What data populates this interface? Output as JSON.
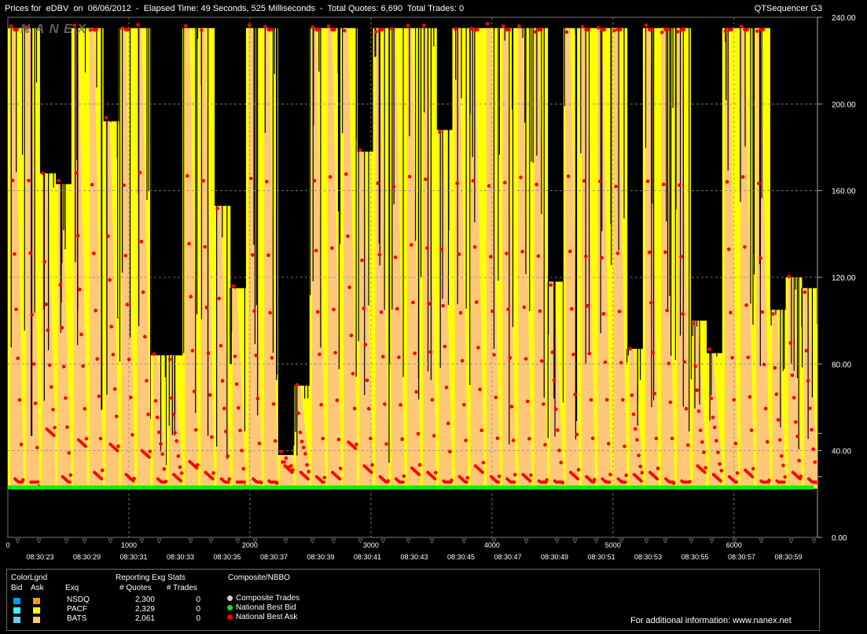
{
  "header": {
    "title": "Prices for  eDBV  on  06/06/2012  -  Elapsed Time: 49 Seconds, 525 Milliseconds  -  Total Quotes: 6,690  Total Trades: 0",
    "app_name": "QTSequencer G3",
    "watermark": "NANEX"
  },
  "colors": {
    "background": "#000000",
    "pacf_ask": "#ffff00",
    "bats_ask": "#ffc77a",
    "nsdq_ask": "#ff9900",
    "nbbo_bid": "#00ee00",
    "nbbo_ask": "#ff0000",
    "grid": "#8a8a8a"
  },
  "chart_data": {
    "type": "area",
    "y_ticks": [
      "240.00",
      "200.00",
      "160.00",
      "120.00",
      "80.00",
      "40.00",
      "0.00"
    ],
    "ylim": [
      0,
      240
    ],
    "x_ticks": [
      "0",
      "1000",
      "2000",
      "3000",
      "4000",
      "5000",
      "6000"
    ],
    "xlim": [
      0,
      6690
    ],
    "time_labels": [
      "08:30:23",
      "08:30:29",
      "08:30:31",
      "08:30:33",
      "08:30:35",
      "08:30:37",
      "08:30:39",
      "08:30:41",
      "08:30:43",
      "08:30:45",
      "08:30:47",
      "08:30:49",
      "08:30:51",
      "08:30:53",
      "08:30:55",
      "08:30:57",
      "08:30:59"
    ],
    "grid": true,
    "series": [
      {
        "name": "National Best Bid",
        "values": [
          23,
          23
        ]
      },
      {
        "name": "National Best Ask",
        "note": "sawtooth pattern, approx 27-45"
      }
    ],
    "envelope": [
      235,
      235,
      168,
      163,
      235,
      235,
      192,
      235,
      235,
      84,
      84,
      235,
      235,
      153,
      115,
      235,
      235,
      38,
      70,
      235,
      235,
      235,
      178,
      235,
      235,
      235,
      235,
      188,
      235,
      235,
      235,
      235,
      235,
      235,
      118,
      235,
      235,
      235,
      235,
      87,
      235,
      235,
      235,
      100,
      85,
      235,
      235,
      235,
      105,
      120,
      115
    ],
    "troughs": [
      27,
      25,
      50,
      28,
      45,
      30,
      43,
      29,
      40,
      27,
      29,
      35,
      30,
      27,
      24,
      27,
      26,
      33,
      30,
      28,
      30,
      44,
      33,
      28,
      27,
      32,
      30,
      26,
      28,
      33,
      28,
      27,
      29,
      26,
      26,
      30,
      28,
      27,
      27,
      29,
      30,
      27,
      26,
      33,
      29,
      28,
      31,
      26,
      26,
      30,
      27
    ]
  },
  "legend": {
    "color_legend": "ColorLgnd",
    "bid_label": "Bid",
    "ask_label": "Ask",
    "exq_label": "Exq",
    "stats_title": "Reporting Exg Stats",
    "quotes_header": "# Quotes",
    "trades_header": "# Trades",
    "composite_title": "Composite/NBBO",
    "exchanges": [
      {
        "name": "NSDQ",
        "quotes": "2,300",
        "trades": "0",
        "bid_color": "#0099ff",
        "ask_color": "#ff9900"
      },
      {
        "name": "PACF",
        "quotes": "2,329",
        "trades": "0",
        "bid_color": "#33ffff",
        "ask_color": "#ffff00"
      },
      {
        "name": "BATS",
        "quotes": "2,061",
        "trades": "0",
        "bid_color": "#66ccff",
        "ask_color": "#ffc77a"
      }
    ],
    "composite": [
      {
        "label": "Composite Trades",
        "color": "#d0d0d0"
      },
      {
        "label": "National Best Bid",
        "color": "#00ee00"
      },
      {
        "label": "National Best Ask",
        "color": "#ff0000"
      }
    ],
    "footer": "For additional information: www.nanex.net"
  }
}
